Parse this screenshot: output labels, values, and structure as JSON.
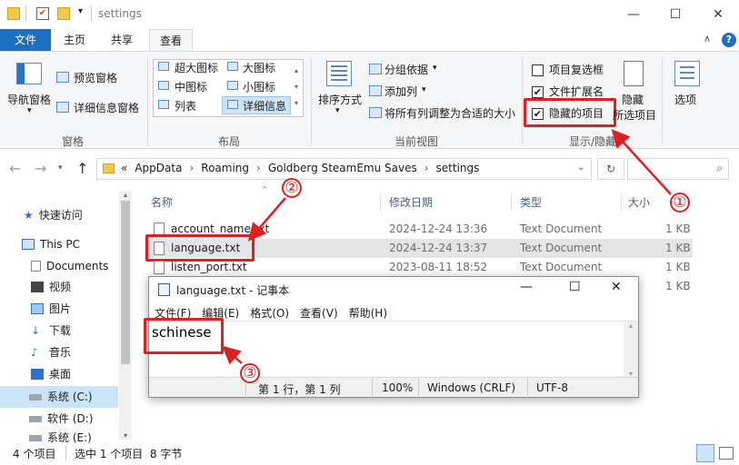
{
  "window": {
    "title": "settings",
    "minimize": "—",
    "maximize": "☐",
    "close": "✕"
  },
  "tabs": {
    "file": "文件",
    "home": "主页",
    "share": "共享",
    "view": "查看"
  },
  "ribbon": {
    "pane": {
      "nav_pane": "导航窗格",
      "preview_pane": "预览窗格",
      "details_pane": "详细信息窗格",
      "group": "窗格"
    },
    "layout": {
      "xl_icons": "超大图标",
      "l_icons": "大图标",
      "m_icons": "中图标",
      "s_icons": "小图标",
      "list": "列表",
      "details": "详细信息",
      "group": "布局"
    },
    "current_view": {
      "sort_by": "排序方式",
      "group_by": "分组依据",
      "add_columns": "添加列",
      "fit_columns": "将所有列调整为合适的大小",
      "group": "当前视图"
    },
    "show_hide": {
      "item_checkboxes": "项目复选框",
      "file_ext": "文件扩展名",
      "hidden_items": "隐藏的项目",
      "hide_selected_1": "隐藏",
      "hide_selected_2": "所选项目",
      "group": "显示/隐藏"
    },
    "options": "选项"
  },
  "address": {
    "crumbs": [
      "«",
      "AppData",
      "Roaming",
      "Goldberg SteamEmu Saves",
      "settings"
    ],
    "search_icon": "search-icon"
  },
  "nav": {
    "items": [
      "快速访问",
      "This PC",
      "Documents",
      "视频",
      "图片",
      "下载",
      "音乐",
      "桌面",
      "系统 (C:)",
      "软件 (D:)",
      "系统 (E:)"
    ]
  },
  "files": {
    "columns": [
      "名称",
      "修改日期",
      "类型",
      "大小"
    ],
    "rows": [
      {
        "name": "account_name.txt",
        "date": "2024-12-24 13:36",
        "type": "Text Document",
        "size": "1 KB"
      },
      {
        "name": "language.txt",
        "date": "2024-12-24 13:37",
        "type": "Text Document",
        "size": "1 KB"
      },
      {
        "name": "listen_port.txt",
        "date": "2023-08-11 18:52",
        "type": "Text Document",
        "size": "1 KB"
      },
      {
        "name": "",
        "date": "",
        "type": "",
        "size": "1 KB"
      }
    ]
  },
  "notepad": {
    "title": "language.txt - 记事本",
    "menu": [
      "文件(F)",
      "编辑(E)",
      "格式(O)",
      "查看(V)",
      "帮助(H)"
    ],
    "content": "schinese",
    "status": {
      "pos": "第 1 行，第 1 列",
      "zoom": "100%",
      "eol": "Windows (CRLF)",
      "encoding": "UTF-8"
    }
  },
  "statusbar": {
    "count": "4 个项目",
    "selected": "选中 1 个项目  8 字节"
  },
  "annotations": [
    "①",
    "②",
    "③"
  ],
  "colors": {
    "accent": "#1f6fbf",
    "callout": "#e02020",
    "selected_row": "#e5e5e5"
  }
}
